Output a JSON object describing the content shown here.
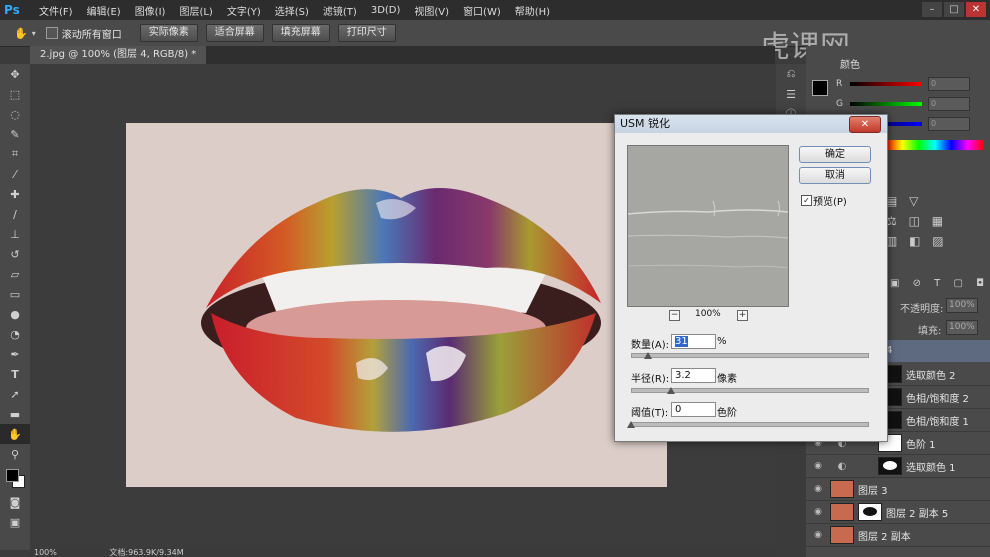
{
  "app": {
    "logo": "Ps"
  },
  "menu": [
    "文件(F)",
    "编辑(E)",
    "图像(I)",
    "图层(L)",
    "文字(Y)",
    "选择(S)",
    "滤镜(T)",
    "3D(D)",
    "视图(V)",
    "窗口(W)",
    "帮助(H)"
  ],
  "options_bar": {
    "scroll_all_label": "滚动所有窗口",
    "buttons": [
      "实际像素",
      "适合屏幕",
      "填充屏幕",
      "打印尺寸"
    ]
  },
  "document": {
    "tab_title": "2.jpg @ 100% (图层 4, RGB/8) *"
  },
  "status": {
    "zoom": "100%",
    "doc_info": "文档:963.9K/9.34M"
  },
  "watermark": "虎课网",
  "color_panel": {
    "tab": "颜色",
    "channels": [
      "R",
      "G",
      "B"
    ],
    "values": [
      "0",
      "0",
      "0"
    ]
  },
  "layers_panel": {
    "opacity_label": "不透明度:",
    "opacity_value": "100%",
    "fill_label": "填充:",
    "fill_value": "100%",
    "selected_fragment": "4",
    "layers": [
      {
        "name": "选取颜色 2"
      },
      {
        "name": "色相/饱和度 2"
      },
      {
        "name": "色相/饱和度 1"
      },
      {
        "name": "色阶 1"
      },
      {
        "name": "选取颜色 1"
      },
      {
        "name": "图层 3"
      },
      {
        "name": "图层 2 副本 5"
      },
      {
        "name": "图层 2 副本"
      }
    ]
  },
  "dialog": {
    "title": "USM 锐化",
    "ok_label": "确定",
    "cancel_label": "取消",
    "preview_label": "预览(P)",
    "preview_zoom": "100%",
    "amount_label": "数量(A):",
    "amount_value": "31",
    "amount_unit": "%",
    "amount_level": 0.07,
    "radius_label": "半径(R):",
    "radius_value": "3.2",
    "radius_unit": "像素",
    "radius_level": 0.17,
    "threshold_label": "阈值(T):",
    "threshold_value": "0",
    "threshold_unit": "色阶",
    "threshold_level": 0.0
  }
}
